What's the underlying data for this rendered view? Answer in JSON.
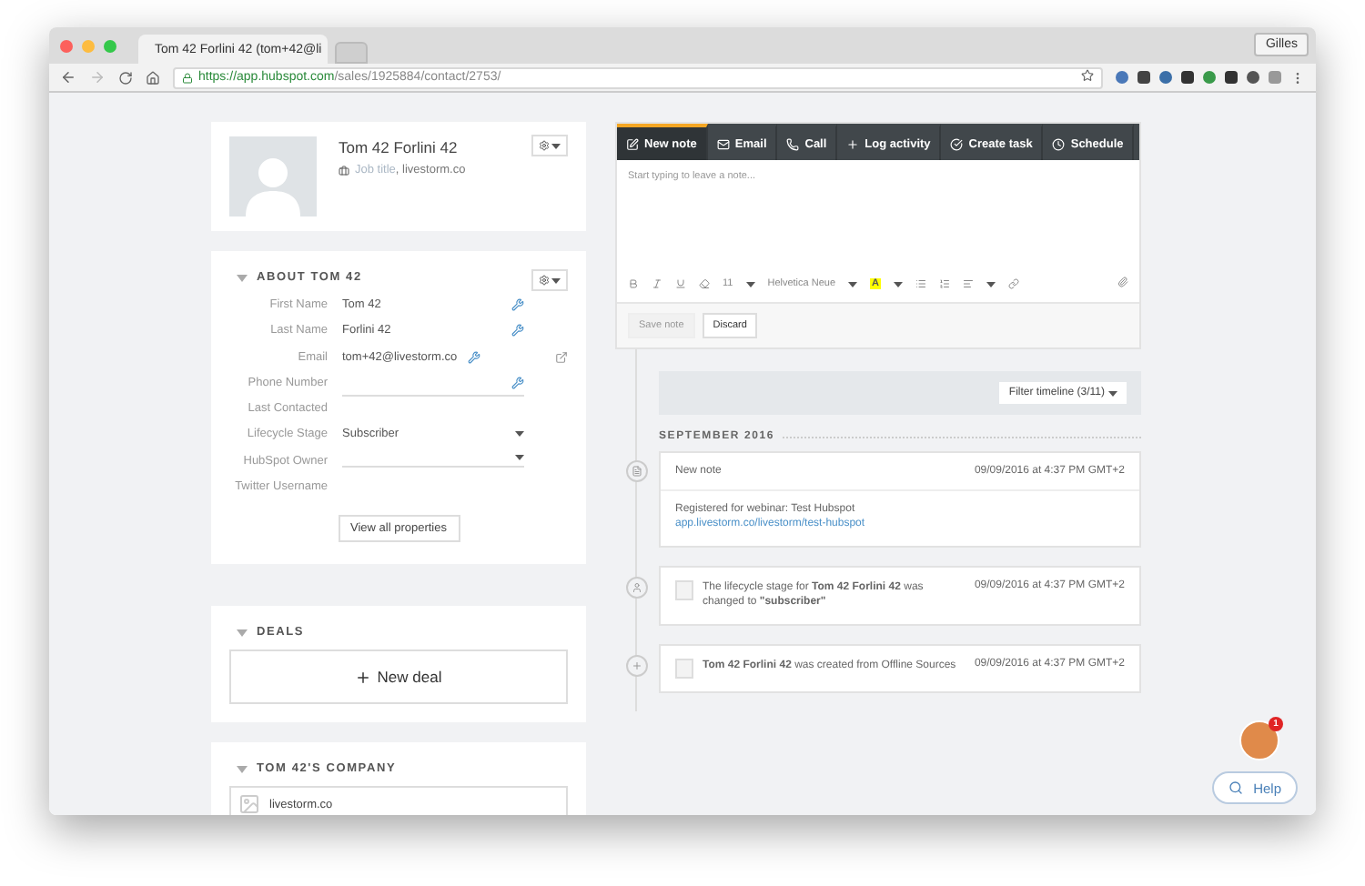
{
  "browser": {
    "tab_title": "Tom 42 Forlini 42 (tom+42@li",
    "url_host": "https://app.hubspot.com",
    "url_path": "/sales/1925884/contact/2753/",
    "profile": "Gilles"
  },
  "contact": {
    "name": "Tom 42 Forlini 42",
    "job_title": "Job title",
    "company": ", livestorm.co"
  },
  "about": {
    "title": "ABOUT TOM 42",
    "expanded": true,
    "properties": [
      {
        "label": "First Name",
        "value": "Tom 42",
        "kind": "text"
      },
      {
        "label": "Last Name",
        "value": "Forlini 42",
        "kind": "text"
      },
      {
        "label": "Email",
        "value": "tom+42@livestorm.co",
        "kind": "email"
      },
      {
        "label": "Phone Number",
        "kind": "text"
      },
      {
        "label": "Last Contacted",
        "kind": "readonly"
      },
      {
        "label": "Lifecycle Stage",
        "value": "Subscriber",
        "kind": "select"
      },
      {
        "label": "HubSpot Owner",
        "kind": "select"
      },
      {
        "label": "Twitter Username",
        "kind": "readonly"
      }
    ],
    "button": "View all properties"
  },
  "deals": {
    "title": "DEALS",
    "expanded": true,
    "button": "New deal"
  },
  "company": {
    "title": "TOM 42'S COMPANY",
    "expanded": true,
    "name": "livestorm.co"
  },
  "composer": {
    "tabs": [
      {
        "label": "New note",
        "selected": true
      },
      {
        "label": "Email",
        "selected": false
      },
      {
        "label": "Call",
        "selected": false
      },
      {
        "label": "Log activity",
        "selected": false
      },
      {
        "label": "Create task",
        "selected": false
      },
      {
        "label": "Schedule",
        "selected": false
      }
    ],
    "placeholder": "Start typing to leave a note...",
    "font_size": "11",
    "font": "Helvetica Neue",
    "text_color_glyph": "A",
    "buttons": [
      {
        "label": "Save note",
        "disabled": true
      },
      {
        "label": "Discard",
        "disabled": false
      }
    ]
  },
  "timeline": {
    "filter": "Filter timeline (3/11)",
    "month": "SEPTEMBER 2016",
    "events": [
      {
        "kind": "note",
        "title": "New note",
        "time": "09/09/2016 at 4:37 PM GMT+2",
        "body": "Registered for webinar: Test Hubspot",
        "link": "app.livestorm.co/livestorm/test-hubspot"
      },
      {
        "kind": "lifecycle",
        "text": "The lifecycle stage for **Tom 42 Forlini 42** was changed to **\"subscriber\"**",
        "time": "09/09/2016 at 4:37 PM GMT+2"
      },
      {
        "kind": "created",
        "text": "**Tom 42 Forlini 42** was created from Offline Sources",
        "time": "09/09/2016 at 4:37 PM GMT+2"
      }
    ]
  },
  "help": {
    "badge": "1",
    "label": "Help"
  }
}
